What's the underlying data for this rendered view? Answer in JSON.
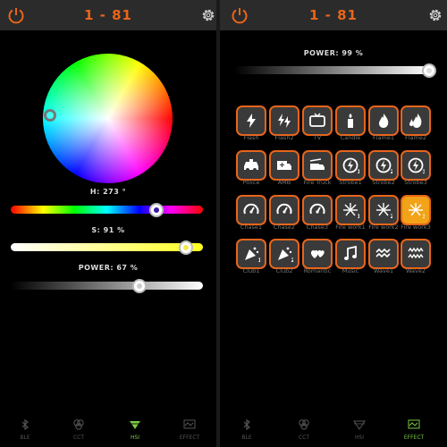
{
  "colors": {
    "accent": "#e8651a",
    "active_tile": "#f2a317",
    "nav_active": "#7ac943"
  },
  "left": {
    "title": "1 - 81",
    "hue": {
      "label": "H: 273 °",
      "value": 273,
      "max": 360
    },
    "saturation": {
      "label": "S: 91 %",
      "value": 91
    },
    "power": {
      "label": "POWER: 67 %",
      "value": 67
    }
  },
  "right": {
    "title": "1 - 81",
    "power": {
      "label": "POWER: 99 %",
      "value": 99
    },
    "effects": [
      {
        "label": "Flash",
        "icon": "bolt-icon"
      },
      {
        "label": "Flash2",
        "icon": "double-bolt-icon"
      },
      {
        "label": "TV",
        "icon": "tv-icon"
      },
      {
        "label": "Candle",
        "icon": "candle-icon"
      },
      {
        "label": "Flame1",
        "icon": "flame-icon"
      },
      {
        "label": "Flame2",
        "icon": "double-flame-icon"
      },
      {
        "label": "Police",
        "icon": "police-car-icon"
      },
      {
        "label": "AMB",
        "icon": "ambulance-icon"
      },
      {
        "label": "Fire Truck",
        "icon": "fire-truck-icon"
      },
      {
        "label": "Strobe1",
        "icon": "strobe-1-icon",
        "badge": "1"
      },
      {
        "label": "Strobe2",
        "icon": "strobe-2-icon",
        "badge": "2"
      },
      {
        "label": "Strobe3",
        "icon": "strobe-3-icon",
        "badge": "3"
      },
      {
        "label": "Chase1",
        "icon": "chase-1-icon"
      },
      {
        "label": "Chase2",
        "icon": "chase-2-icon"
      },
      {
        "label": "Chase3",
        "icon": "chase-3-icon"
      },
      {
        "label": "Fire work1",
        "icon": "firework-1-icon",
        "badge": "1"
      },
      {
        "label": "Fire work2",
        "icon": "firework-2-icon",
        "badge": "2"
      },
      {
        "label": "Fire work3",
        "icon": "firework-3-icon",
        "badge": "3",
        "active": true
      },
      {
        "label": "Club1",
        "icon": "club-1-icon",
        "badge": "1"
      },
      {
        "label": "Club2",
        "icon": "club-2-icon",
        "badge": "2"
      },
      {
        "label": "Romantic",
        "icon": "hearts-icon"
      },
      {
        "label": "Music",
        "icon": "music-note-icon"
      },
      {
        "label": "Wave1",
        "icon": "wave-1-icon"
      },
      {
        "label": "Wave2",
        "icon": "wave-2-icon"
      }
    ]
  },
  "nav_left": [
    {
      "label": "BLE",
      "icon": "bluetooth-icon"
    },
    {
      "label": "CCT",
      "icon": "cct-circles-icon"
    },
    {
      "label": "HSI",
      "icon": "hsi-funnel-icon",
      "active": true
    },
    {
      "label": "EFFECT",
      "icon": "effect-icon"
    }
  ],
  "nav_right": [
    {
      "label": "BLE",
      "icon": "bluetooth-icon"
    },
    {
      "label": "CCT",
      "icon": "cct-circles-icon"
    },
    {
      "label": "HSI",
      "icon": "hsi-funnel-icon"
    },
    {
      "label": "EFFECT",
      "icon": "effect-icon",
      "active": true
    }
  ]
}
